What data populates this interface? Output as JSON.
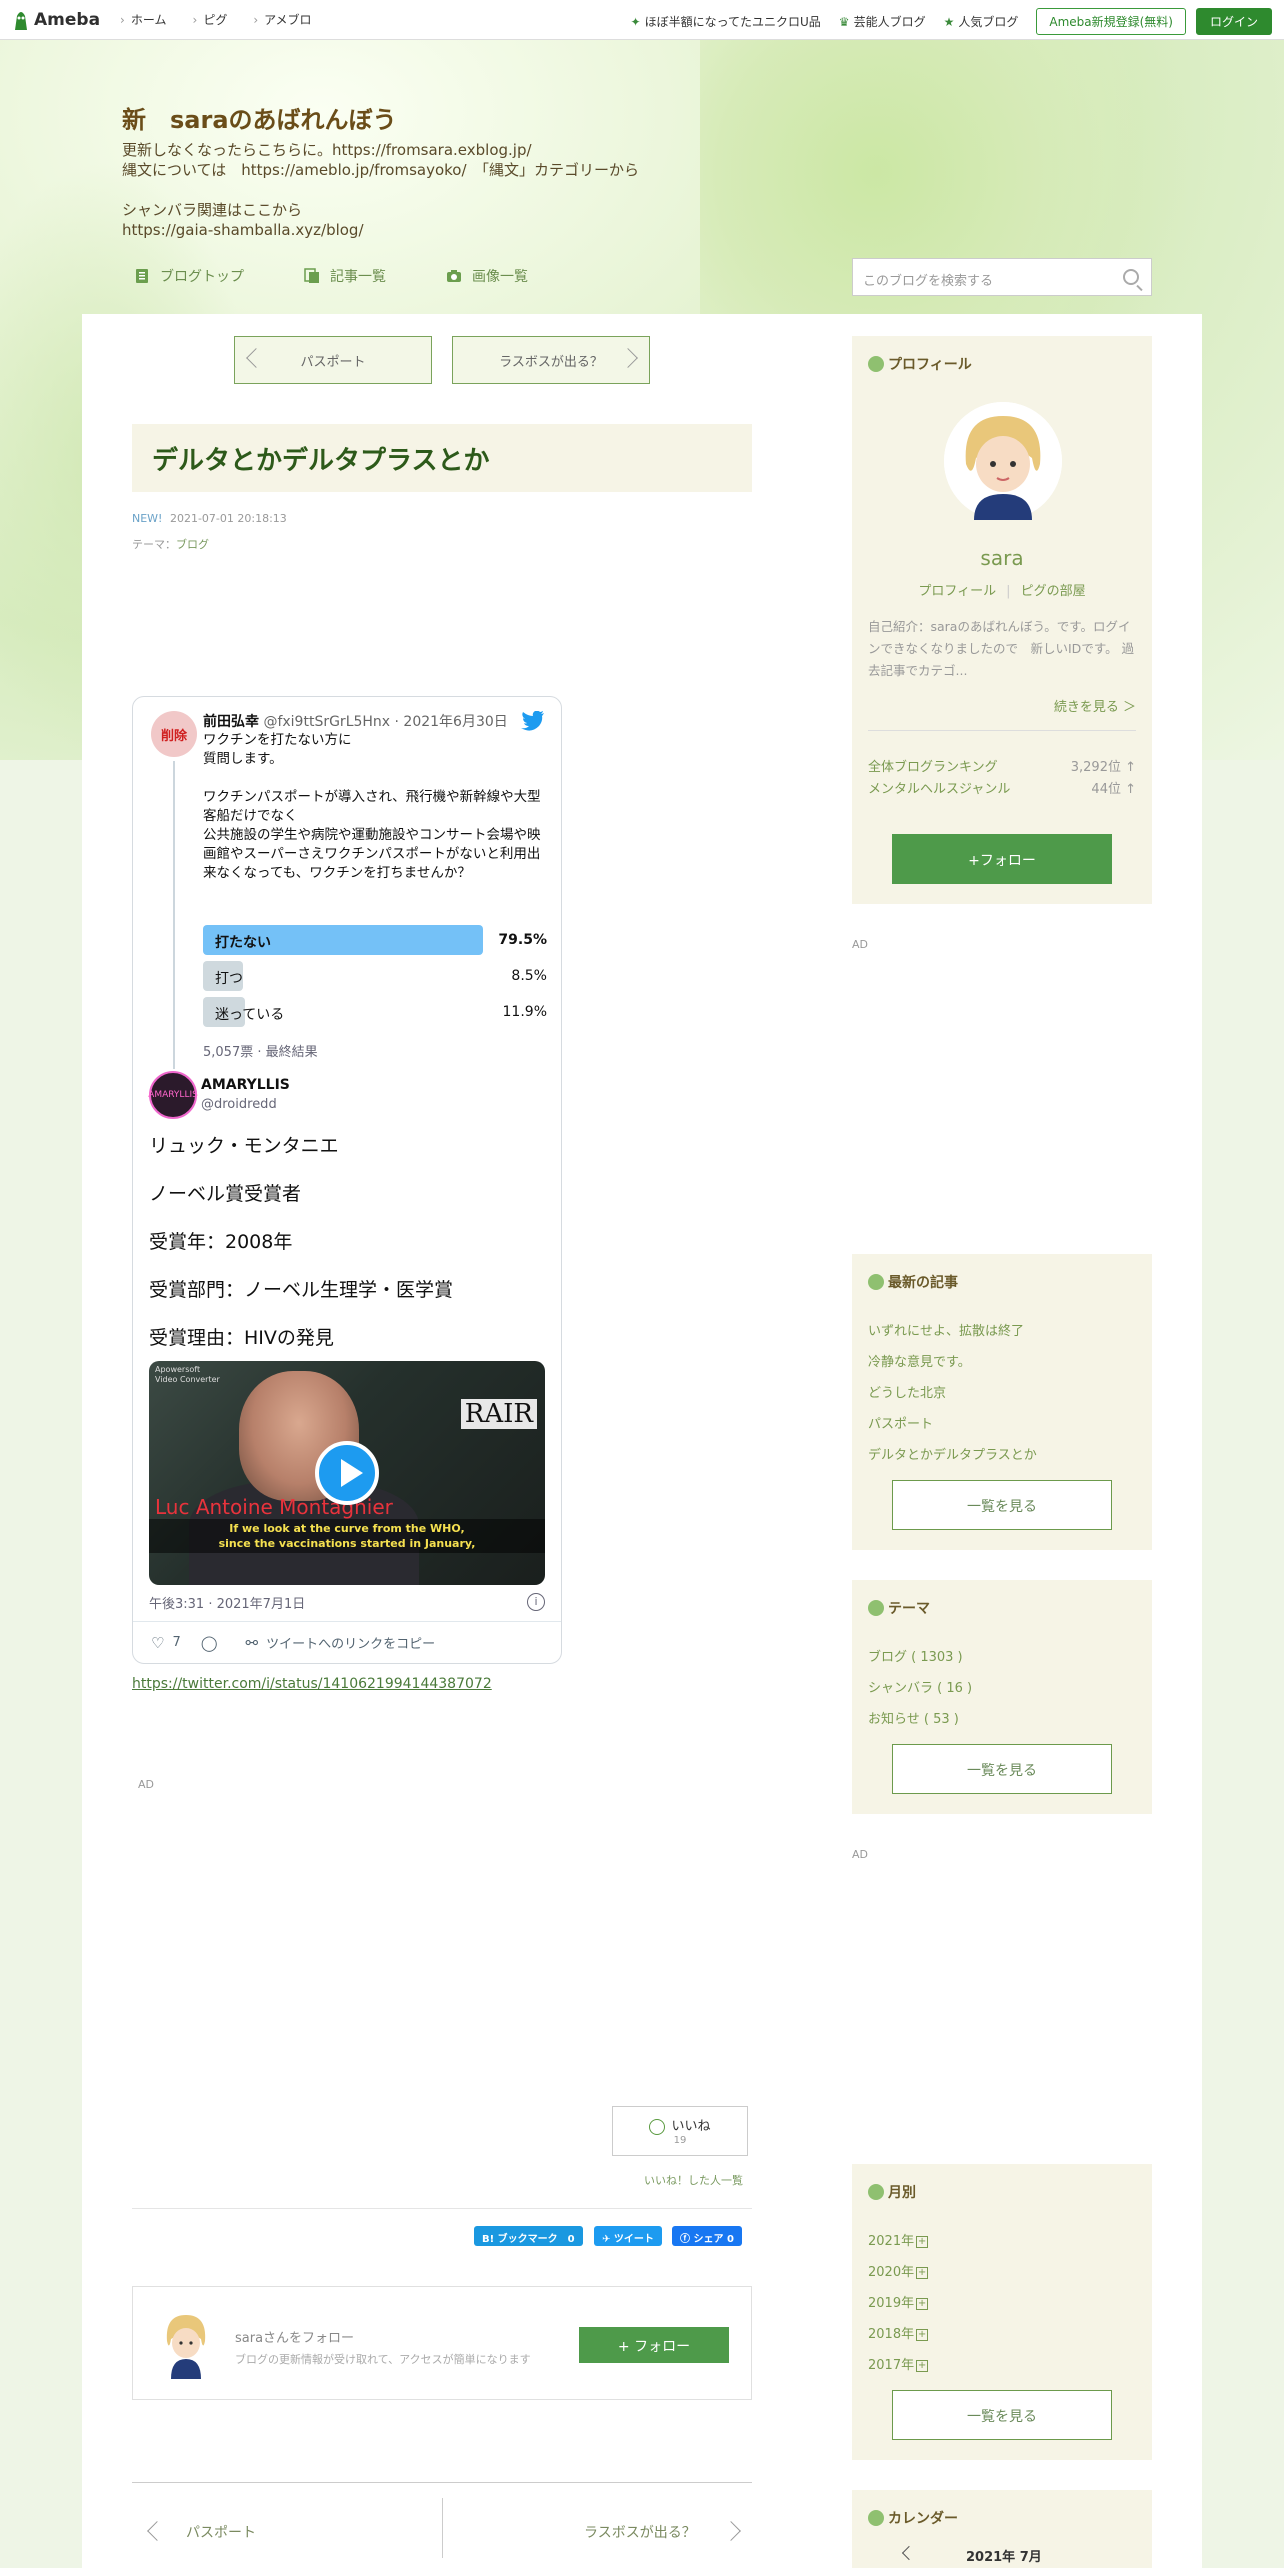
{
  "topbar": {
    "logo": "Ameba",
    "nav_left": [
      "ホーム",
      "ピグ",
      "アメブロ"
    ],
    "nav_right": [
      "ほぼ半額になってたユニクロU品",
      "芸能人ブログ",
      "人気ブログ"
    ],
    "register": "Ameba新規登録(無料)",
    "login": "ログイン"
  },
  "blog": {
    "title": "新　saraのあばれんぼう",
    "desc": [
      "更新しなくなったらこちらに。https://fromsara.exblog.jp/",
      "縄文については　https://ameblo.jp/fromsayoko/　「縄文」カテゴリーから",
      "",
      "シャンバラ関連はここから",
      "https://gaia-shamballa.xyz/blog/"
    ],
    "nav": [
      "ブログトップ",
      "記事一覧",
      "画像一覧"
    ],
    "search_placeholder": "このブログを検索する"
  },
  "pager": {
    "prev": "パスポート",
    "next": "ラスボスが出る？"
  },
  "article": {
    "title": "デルタとかデルタプラスとか",
    "new": "NEW!",
    "date": "2021-07-01 20:18:13",
    "theme_label": "テーマ：",
    "theme": "ブログ"
  },
  "tweet": {
    "avatar_text": "削除",
    "name": "前田弘幸",
    "handle": "@fxi9ttSrGrL5Hnx · 2021年6月30日",
    "text": "ワクチンを打たない方に\n質問します。\n\nワクチンパスポートが導入され、飛行機や新幹線や大型客船だけでなく\n公共施設の学生や病院や運動施設やコンサート会場や映画館やスーパーさえワクチンパスポートがないと利用出来なくなっても、ワクチンを打ちませんか？",
    "poll": [
      {
        "label": "打たない",
        "pct": "79.5%",
        "value": 79.5
      },
      {
        "label": "打つ",
        "pct": "8.5%",
        "value": 8.5
      },
      {
        "label": "迷っている",
        "pct": "11.9%",
        "value": 11.9
      }
    ],
    "poll_meta": "5,057票 · 最終結果",
    "reply_avatar_text": "AMARYLLIS",
    "reply_name": "AMARYLLIS",
    "reply_handle": "@droidredd",
    "reply_lines": [
      "リュック・モンタニエ",
      "ノーベル賞受賞者",
      "受賞年：2008年",
      "受賞部門：ノーベル生理学・医学賞",
      "受賞理由：HIVの発見"
    ],
    "video": {
      "watermark": "Apowersoft\nVideo Converter",
      "logo": "RAIR",
      "name_overlay": "Luc Antoine Montagnier",
      "subtitle": "If we look at the curve from the WHO,\nsince the vaccinations started in January,"
    },
    "time": "午後3:31 · 2021年7月1日",
    "likes": "7",
    "copy_link": "ツイートへのリンクをコピー"
  },
  "tweet_link": "https://twitter.com/i/status/1410621994144387072",
  "ad": "AD",
  "like": {
    "label": "いいね",
    "count": "19",
    "list": "いいね！した人一覧"
  },
  "share": {
    "hatena": "B! ブックマーク　0",
    "tweet": "ツイート",
    "facebook": "シェア 0"
  },
  "follow_box": {
    "title": "saraさんをフォロー",
    "sub": "ブログの更新情報が受け取れて、アクセスが簡単になります",
    "button": "+ フォロー"
  },
  "bottom_pager": {
    "prev": "パスポート",
    "next": "ラスボスが出る？"
  },
  "sidebar": {
    "profile": {
      "heading": "プロフィール",
      "name": "sara",
      "links": [
        "プロフィール",
        "ピグの部屋"
      ],
      "intro": "自己紹介：saraのあばれんぼう。です。ログインできなくなりましたので　新しいIDです。 過去記事でカテゴ...",
      "more": "続きを見る ＞",
      "ranks": [
        {
          "label": "全体ブログランキング",
          "value": "3,292位 ↑"
        },
        {
          "label": "メンタルヘルスジャンル",
          "value": "44位 ↑"
        }
      ],
      "follow": "+フォロー"
    },
    "recent": {
      "heading": "最新の記事",
      "items": [
        "いずれにせよ、拡散は終了",
        "冷静な意見です。",
        "どうした北京",
        "パスポート",
        "デルタとかデルタプラスとか"
      ],
      "more": "一覧を見る"
    },
    "themes": {
      "heading": "テーマ",
      "items": [
        "ブログ ( 1303 )",
        "シャンバラ ( 16 )",
        "お知らせ ( 53 )"
      ],
      "more": "一覧を見る"
    },
    "monthly": {
      "heading": "月別",
      "items": [
        "2021年",
        "2020年",
        "2019年",
        "2018年",
        "2017年"
      ],
      "more": "一覧を見る"
    },
    "calendar": {
      "heading": "カレンダー",
      "month": "2021年 7月"
    }
  }
}
